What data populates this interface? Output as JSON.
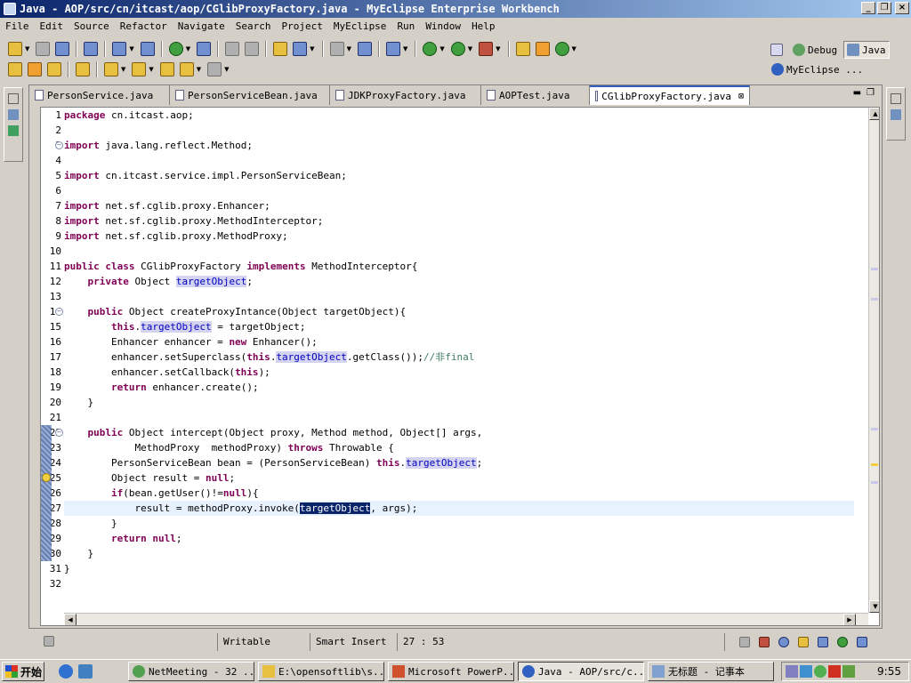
{
  "window": {
    "title": "Java - AOP/src/cn/itcast/aop/CGlibProxyFactory.java - MyEclipse Enterprise Workbench",
    "min_glyph": "_",
    "max_glyph": "❐",
    "close_glyph": "×"
  },
  "menu": [
    "File",
    "Edit",
    "Source",
    "Refactor",
    "Navigate",
    "Search",
    "Project",
    "MyEclipse",
    "Run",
    "Window",
    "Help"
  ],
  "perspectives": {
    "debug": "Debug",
    "java": "Java",
    "myeclipse": "MyEclipse ..."
  },
  "tabs": [
    {
      "label": "PersonService.java",
      "active": false
    },
    {
      "label": "PersonServiceBean.java",
      "active": false
    },
    {
      "label": "JDKProxyFactory.java",
      "active": false
    },
    {
      "label": "AOPTest.java",
      "active": false
    },
    {
      "label": "CGlibProxyFactory.java",
      "active": true
    }
  ],
  "tab_close_glyph": "⊠",
  "code_lines": [
    "package cn.itcast.aop;",
    "",
    "import java.lang.reflect.Method;",
    "",
    "import cn.itcast.service.impl.PersonServiceBean;",
    "",
    "import net.sf.cglib.proxy.Enhancer;",
    "import net.sf.cglib.proxy.MethodInterceptor;",
    "import net.sf.cglib.proxy.MethodProxy;",
    "",
    "public class CGlibProxyFactory implements MethodInterceptor{",
    "    private Object targetObject;",
    "",
    "    public Object createProxyIntance(Object targetObject){",
    "        this.targetObject = targetObject;",
    "        Enhancer enhancer = new Enhancer();",
    "        enhancer.setSuperclass(this.targetObject.getClass());//非final",
    "        enhancer.setCallback(this);",
    "        return enhancer.create();",
    "    }",
    "",
    "    public Object intercept(Object proxy, Method method, Object[] args,",
    "            MethodProxy  methodProxy) throws Throwable {",
    "        PersonServiceBean bean = (PersonServiceBean) this.targetObject;",
    "        Object result = null;",
    "        if(bean.getUser()!=null){",
    "            result = methodProxy.invoke(targetObject, args);",
    "        }",
    "        return null;",
    "    }",
    "}",
    ""
  ],
  "status": {
    "mode": "Writable",
    "insert": "Smart Insert",
    "position": "27 : 53"
  },
  "taskbar": {
    "start": "开始",
    "tasks": [
      {
        "label": "NetMeeting - 32 ..."
      },
      {
        "label": "E:\\opensoftlib\\s..."
      },
      {
        "label": "Microsoft PowerP..."
      },
      {
        "label": "Java - AOP/src/c..."
      },
      {
        "label": "无标题 - 记事本"
      }
    ],
    "clock": "9:55"
  }
}
